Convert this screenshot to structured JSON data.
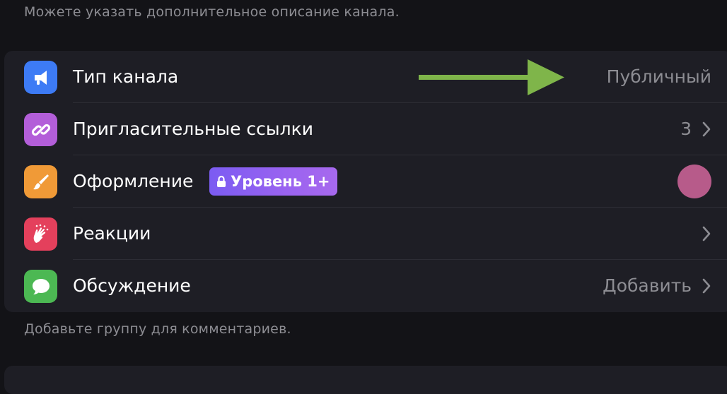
{
  "header_hint": "Можете указать дополнительное описание канала.",
  "footer_hint": "Добавьте группу для комментариев.",
  "rows": [
    {
      "label": "Тип канала",
      "value": "Публичный",
      "icon": "megaphone-icon",
      "icon_color": "#3d7bf5"
    },
    {
      "label": "Пригласительные ссылки",
      "value": "3",
      "icon": "link-icon",
      "icon_color": "#b35ed9"
    },
    {
      "label": "Оформление",
      "badge": "Уровень 1+",
      "icon": "paintbrush-icon",
      "icon_color": "#f09a37",
      "swatch_color": "#b75b8a"
    },
    {
      "label": "Реакции",
      "value": "",
      "icon": "clapping-hands-icon",
      "icon_color": "#e4405c"
    },
    {
      "label": "Обсуждение",
      "value": "Добавить",
      "icon": "speech-bubble-icon",
      "icon_color": "#4cb853"
    }
  ],
  "annotation": {
    "type": "arrow",
    "color": "#7fb54a",
    "points_to": "Публичный"
  }
}
